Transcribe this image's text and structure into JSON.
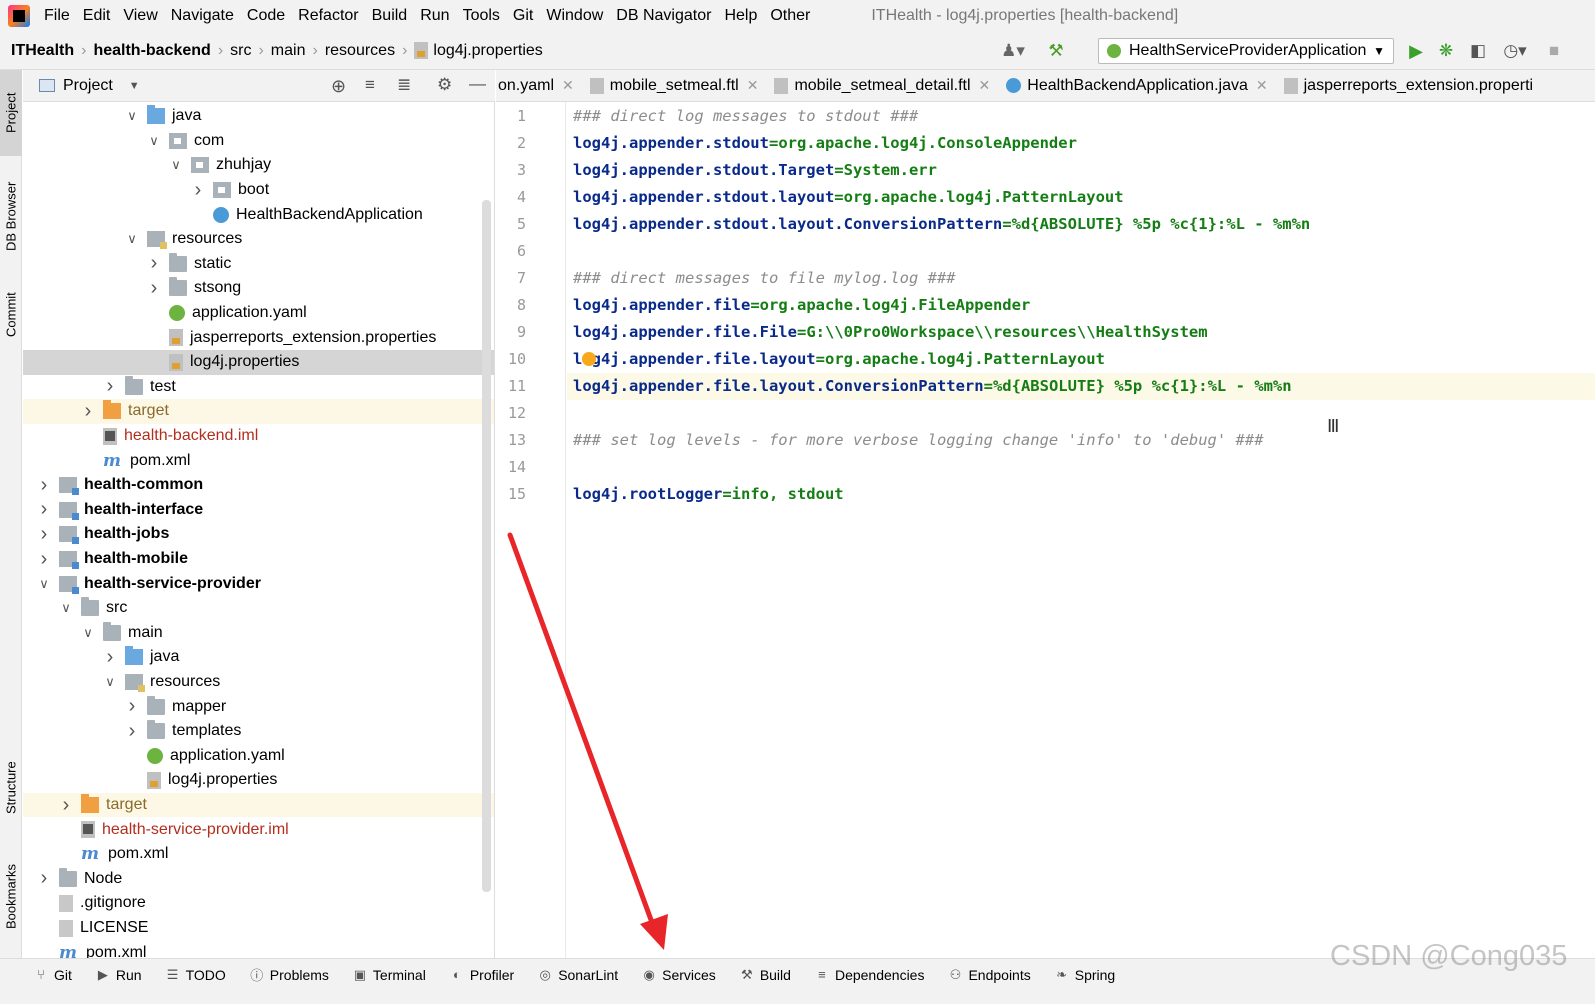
{
  "menubar": {
    "items": [
      "File",
      "Edit",
      "View",
      "Navigate",
      "Code",
      "Refactor",
      "Build",
      "Run",
      "Tools",
      "Git",
      "Window",
      "DB Navigator",
      "Help",
      "Other"
    ],
    "window_title": "ITHealth - log4j.properties [health-backend]"
  },
  "navbar": {
    "crumbs": [
      "ITHealth",
      "health-backend",
      "src",
      "main",
      "resources",
      "log4j.properties"
    ],
    "run_config": "HealthServiceProviderApplication"
  },
  "left_strip": {
    "tabs": [
      "Project",
      "DB Browser",
      "Commit",
      "Structure",
      "Bookmarks"
    ]
  },
  "project_panel": {
    "title": "Project"
  },
  "tree": [
    {
      "label": "java",
      "indent": 5,
      "chev": "v",
      "icon": "src"
    },
    {
      "label": "com",
      "indent": 6,
      "chev": "v",
      "icon": "pkg"
    },
    {
      "label": "zhuhjay",
      "indent": 7,
      "chev": "v",
      "icon": "pkg"
    },
    {
      "label": "boot",
      "indent": 8,
      "chev": ">",
      "icon": "pkg"
    },
    {
      "label": "HealthBackendApplication",
      "indent": 8,
      "chev": "",
      "icon": "cls"
    },
    {
      "label": "resources",
      "indent": 5,
      "chev": "v",
      "icon": "res"
    },
    {
      "label": "static",
      "indent": 6,
      "chev": ">",
      "icon": "folder"
    },
    {
      "label": "stsong",
      "indent": 6,
      "chev": ">",
      "icon": "folder"
    },
    {
      "label": "application.yaml",
      "indent": 6,
      "chev": "",
      "icon": "spring"
    },
    {
      "label": "jasperreports_extension.properties",
      "indent": 6,
      "chev": "",
      "icon": "prop"
    },
    {
      "label": "log4j.properties",
      "indent": 6,
      "chev": "",
      "icon": "prop",
      "sel": true
    },
    {
      "label": "test",
      "indent": 4,
      "chev": ">",
      "icon": "folder"
    },
    {
      "label": "target",
      "indent": 3,
      "chev": ">",
      "icon": "orange",
      "excl": true
    },
    {
      "label": "health-backend.iml",
      "indent": 3,
      "chev": "",
      "icon": "iml",
      "style": "red"
    },
    {
      "label": "pom.xml",
      "indent": 3,
      "chev": "",
      "icon": "mvn"
    },
    {
      "label": "health-common",
      "indent": 1,
      "chev": ">",
      "icon": "module",
      "style": "bold"
    },
    {
      "label": "health-interface",
      "indent": 1,
      "chev": ">",
      "icon": "module",
      "style": "bold"
    },
    {
      "label": "health-jobs",
      "indent": 1,
      "chev": ">",
      "icon": "module",
      "style": "bold"
    },
    {
      "label": "health-mobile",
      "indent": 1,
      "chev": ">",
      "icon": "module",
      "style": "bold"
    },
    {
      "label": "health-service-provider",
      "indent": 1,
      "chev": "v",
      "icon": "module",
      "style": "bold"
    },
    {
      "label": "src",
      "indent": 2,
      "chev": "v",
      "icon": "folder"
    },
    {
      "label": "main",
      "indent": 3,
      "chev": "v",
      "icon": "folder"
    },
    {
      "label": "java",
      "indent": 4,
      "chev": ">",
      "icon": "src"
    },
    {
      "label": "resources",
      "indent": 4,
      "chev": "v",
      "icon": "res"
    },
    {
      "label": "mapper",
      "indent": 5,
      "chev": ">",
      "icon": "folder"
    },
    {
      "label": "templates",
      "indent": 5,
      "chev": ">",
      "icon": "folder"
    },
    {
      "label": "application.yaml",
      "indent": 5,
      "chev": "",
      "icon": "spring"
    },
    {
      "label": "log4j.properties",
      "indent": 5,
      "chev": "",
      "icon": "prop"
    },
    {
      "label": "target",
      "indent": 2,
      "chev": ">",
      "icon": "orange",
      "excl": true
    },
    {
      "label": "health-service-provider.iml",
      "indent": 2,
      "chev": "",
      "icon": "iml",
      "style": "red"
    },
    {
      "label": "pom.xml",
      "indent": 2,
      "chev": "",
      "icon": "mvn"
    },
    {
      "label": "Node",
      "indent": 1,
      "chev": ">",
      "icon": "folder"
    },
    {
      "label": ".gitignore",
      "indent": 1,
      "chev": "",
      "icon": "txt"
    },
    {
      "label": "LICENSE",
      "indent": 1,
      "chev": "",
      "icon": "txt"
    },
    {
      "label": "pom.xml",
      "indent": 1,
      "chev": "",
      "icon": "mvn"
    }
  ],
  "editor_tabs": [
    {
      "label": "on.yaml"
    },
    {
      "label": "mobile_setmeal.ftl"
    },
    {
      "label": "mobile_setmeal_detail.ftl"
    },
    {
      "label": "HealthBackendApplication.java"
    },
    {
      "label": "jasperreports_extension.properti"
    }
  ],
  "code_lines": [
    {
      "n": "1",
      "type": "comment",
      "text": "### direct log messages to stdout ###"
    },
    {
      "n": "2",
      "type": "kv",
      "key": "log4j.appender.stdout",
      "val": "org.apache.log4j.ConsoleAppender"
    },
    {
      "n": "3",
      "type": "kv",
      "key": "log4j.appender.stdout.Target",
      "val": "System.err"
    },
    {
      "n": "4",
      "type": "kv",
      "key": "log4j.appender.stdout.layout",
      "val": "org.apache.log4j.PatternLayout"
    },
    {
      "n": "5",
      "type": "kv",
      "key": "log4j.appender.stdout.layout.ConversionPattern",
      "val": "%d{ABSOLUTE} %5p %c{1}:%L - %m%n"
    },
    {
      "n": "6",
      "type": "empty",
      "text": ""
    },
    {
      "n": "7",
      "type": "comment",
      "text": "### direct messages to file mylog.log ###"
    },
    {
      "n": "8",
      "type": "kv",
      "key": "log4j.appender.file",
      "val": "org.apache.log4j.FileAppender"
    },
    {
      "n": "9",
      "type": "kv",
      "key": "log4j.appender.file.File",
      "val": "G:\\\\0Pro0Workspace\\\\resources\\\\HealthSystem"
    },
    {
      "n": "10",
      "type": "kv",
      "key": "log4j.appender.file.layout",
      "val": "org.apache.log4j.PatternLayout"
    },
    {
      "n": "11",
      "type": "kv",
      "key": "log4j.appender.file.layout.ConversionPattern",
      "val": "%d{ABSOLUTE} %5p %c{1}:%L - %m%n",
      "current": true
    },
    {
      "n": "12",
      "type": "empty",
      "text": ""
    },
    {
      "n": "13",
      "type": "comment",
      "text": "### set log levels - for more verbose logging change 'info' to 'debug' ###"
    },
    {
      "n": "14",
      "type": "empty",
      "text": ""
    },
    {
      "n": "15",
      "type": "kv",
      "key": "log4j.rootLogger",
      "val": "info, stdout"
    }
  ],
  "bottom_tools": [
    {
      "label": "Git",
      "icon": "git-icon"
    },
    {
      "label": "Run",
      "icon": "run-icon"
    },
    {
      "label": "TODO",
      "icon": "todo-icon"
    },
    {
      "label": "Problems",
      "icon": "problems-icon"
    },
    {
      "label": "Terminal",
      "icon": "terminal-icon"
    },
    {
      "label": "Profiler",
      "icon": "profiler-icon"
    },
    {
      "label": "SonarLint",
      "icon": "sonarlint-icon"
    },
    {
      "label": "Services",
      "icon": "services-icon"
    },
    {
      "label": "Build",
      "icon": "build-icon"
    },
    {
      "label": "Dependencies",
      "icon": "dependencies-icon"
    },
    {
      "label": "Endpoints",
      "icon": "endpoints-icon"
    },
    {
      "label": "Spring",
      "icon": "spring-icon"
    }
  ],
  "watermark": "CSDN @Cong035",
  "colors": {
    "arrow": "#e8262a",
    "key": "#0a2a8a",
    "value": "#147d14",
    "comment": "#8c8c8c"
  }
}
